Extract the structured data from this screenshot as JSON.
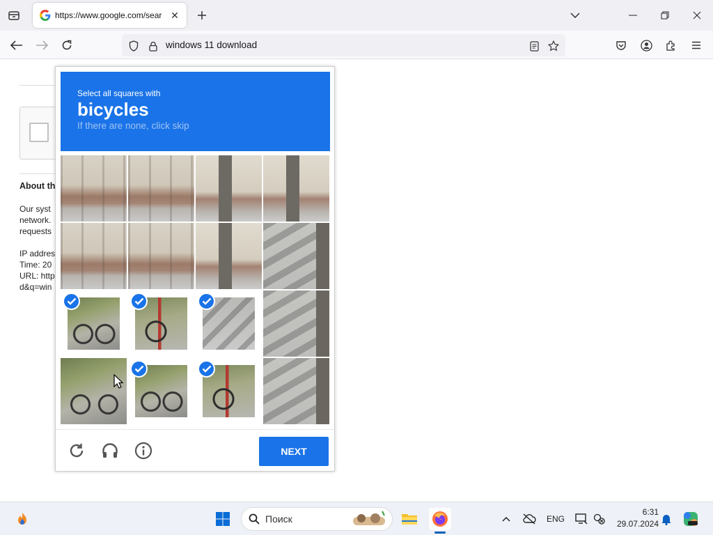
{
  "browser": {
    "tab": {
      "title": "https://www.google.com/sear"
    },
    "address_bar": {
      "text": "windows 11 download"
    }
  },
  "page": {
    "about_heading": "About th",
    "info_lines": [
      "Our syst",
      "network.",
      "requests",
      "",
      "IP addres",
      "Time: 20",
      "URL: http",
      "d&q=win"
    ]
  },
  "captcha": {
    "prompt": "Select all squares with",
    "target": "bicycles",
    "hint": "If there are none, click skip",
    "tiles": [
      {
        "selected": false,
        "image": "building"
      },
      {
        "selected": false,
        "image": "building"
      },
      {
        "selected": false,
        "image": "window"
      },
      {
        "selected": false,
        "image": "window"
      },
      {
        "selected": false,
        "image": "building"
      },
      {
        "selected": false,
        "image": "building"
      },
      {
        "selected": false,
        "image": "window"
      },
      {
        "selected": false,
        "image": "tree"
      },
      {
        "selected": true,
        "image": "bike"
      },
      {
        "selected": true,
        "image": "bike2"
      },
      {
        "selected": true,
        "image": "street"
      },
      {
        "selected": false,
        "image": "tree"
      },
      {
        "selected": false,
        "image": "bike"
      },
      {
        "selected": true,
        "image": "bike"
      },
      {
        "selected": true,
        "image": "bike2"
      },
      {
        "selected": false,
        "image": "tree"
      }
    ],
    "next_label": "NEXT",
    "accent_color": "#1a73e8"
  },
  "taskbar": {
    "search_placeholder": "Поиск",
    "language": "ENG",
    "time": "6:31",
    "date": "29.07.2024"
  }
}
